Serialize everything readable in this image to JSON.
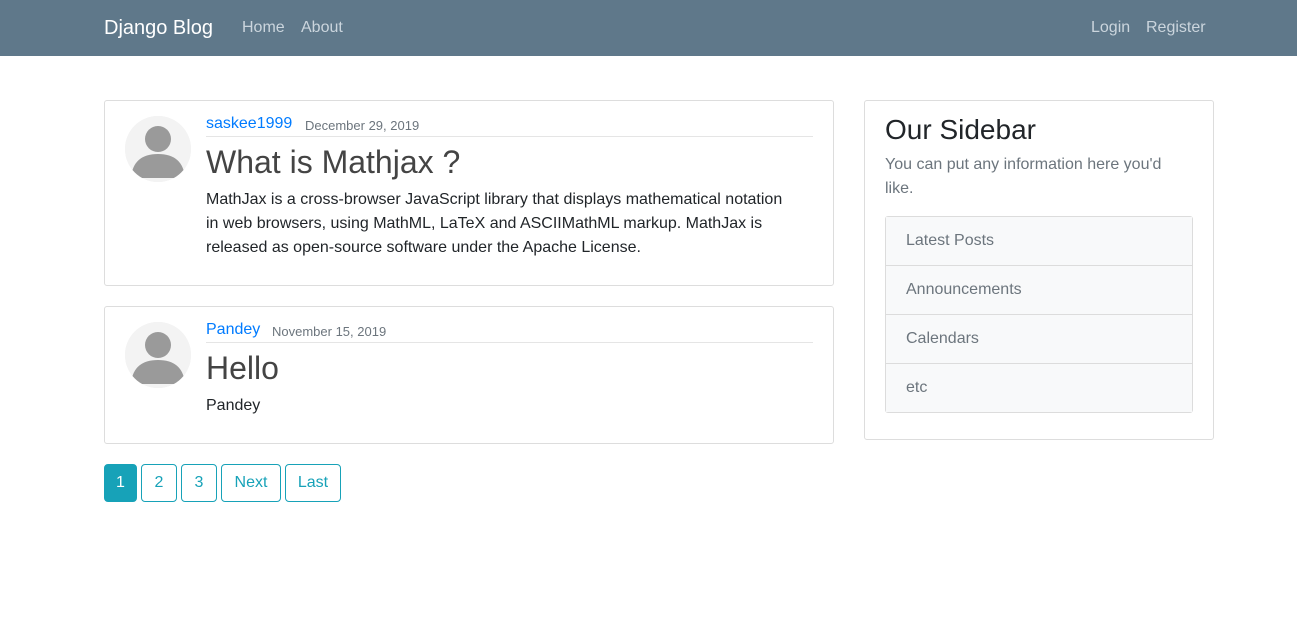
{
  "navbar": {
    "brand": "Django Blog",
    "left_links": [
      "Home",
      "About"
    ],
    "right_links": [
      "Login",
      "Register"
    ]
  },
  "posts": [
    {
      "author": "saskee1999",
      "date": "December 29, 2019",
      "title": "What is Mathjax ?",
      "content": "MathJax is a cross-browser JavaScript library that displays mathematical notation in web browsers, using MathML, LaTeX and ASCIIMathML markup. MathJax is released as open-source software under the Apache License."
    },
    {
      "author": "Pandey",
      "date": "November 15, 2019",
      "title": "Hello",
      "content": "Pandey"
    }
  ],
  "pagination": {
    "pages": [
      "1",
      "2",
      "3"
    ],
    "active": "1",
    "next": "Next",
    "last": "Last"
  },
  "sidebar": {
    "title": "Our Sidebar",
    "text": "You can put any information here you'd like.",
    "items": [
      "Latest Posts",
      "Announcements",
      "Calendars",
      "etc"
    ]
  },
  "colors": {
    "navbar": "#5f788a",
    "link": "#007bff",
    "pagination_accent": "#17a2b8"
  }
}
